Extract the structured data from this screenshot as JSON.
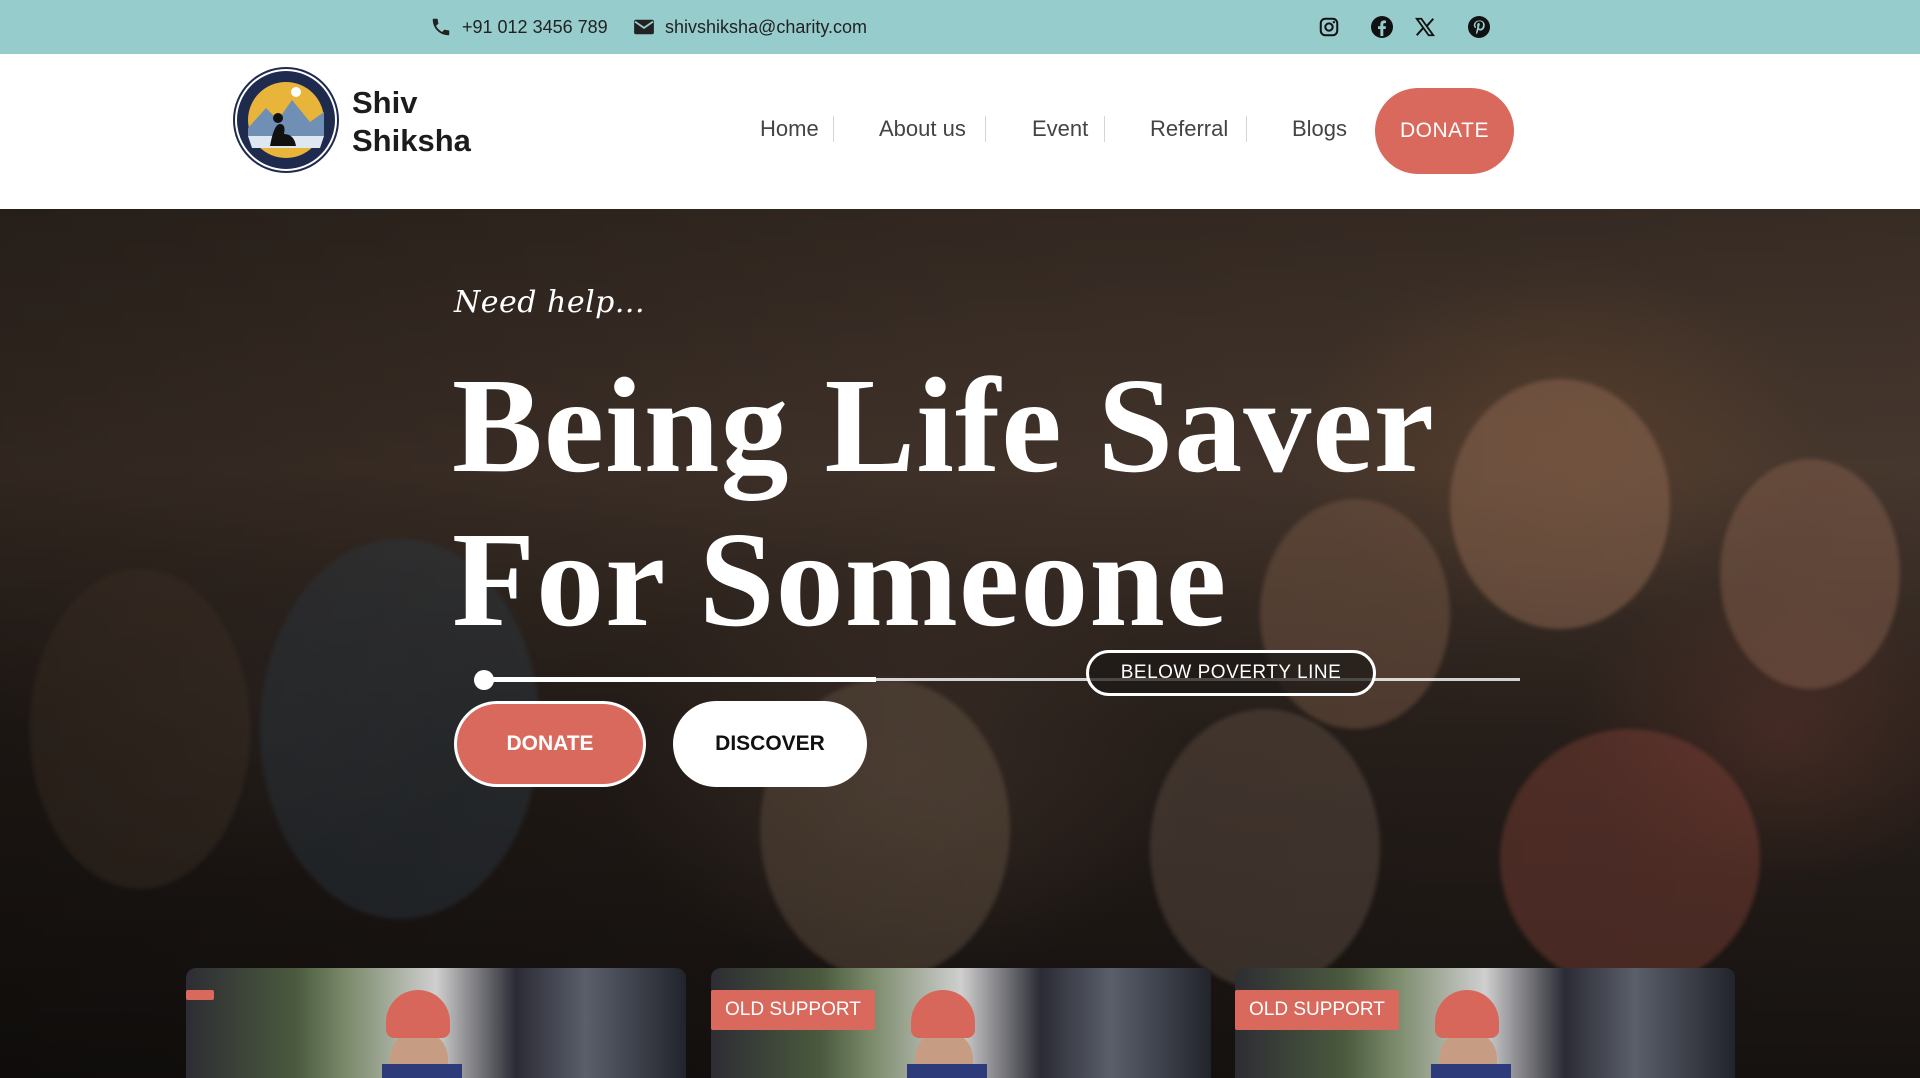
{
  "topbar": {
    "phone": "+91 012 3456 789",
    "email": "shivshiksha@charity.com",
    "social": [
      "instagram-icon",
      "facebook-icon",
      "x-icon",
      "pinterest-icon"
    ],
    "bg_color": "#97cccd"
  },
  "header": {
    "brand_line1": "Shiv",
    "brand_line2": "Shiksha",
    "logo_text": "SHIV SHIKSHA",
    "nav": [
      "Home",
      "About us",
      "Event",
      "Referral",
      "Blogs"
    ],
    "donate_label": "DONATE",
    "accent_color": "#d9695c"
  },
  "hero": {
    "kicker": "Need help...",
    "headline_line1": "Being Life Saver",
    "headline_line2": "For Someone",
    "progress_label": "BELOW POVERTY LINE",
    "progress_value": 0.38,
    "donate_label": "DONATE",
    "discover_label": "DISCOVER"
  },
  "cards": [
    {
      "badge": ""
    },
    {
      "badge": "OLD SUPPORT"
    },
    {
      "badge": "OLD SUPPORT"
    }
  ]
}
